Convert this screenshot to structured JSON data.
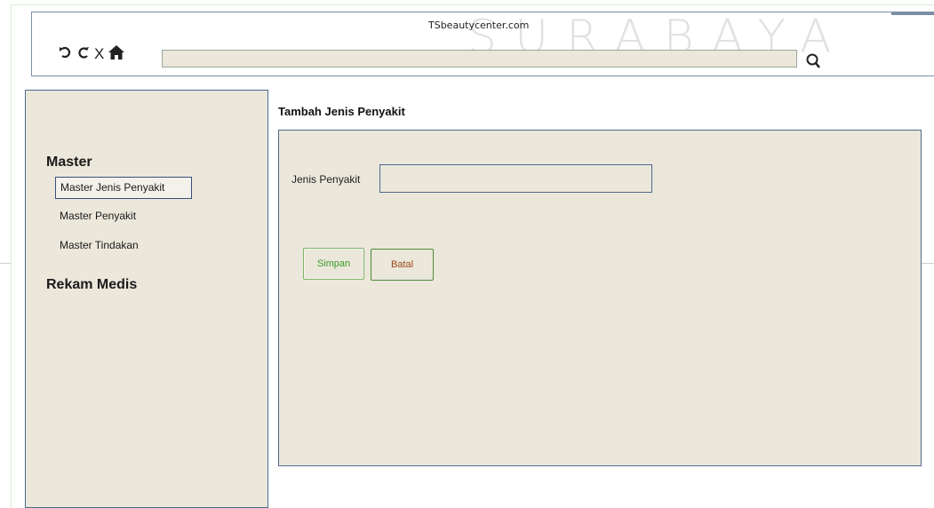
{
  "browser": {
    "site_title": "TSbeautycenter.com",
    "watermark": "SURABAYA",
    "url_value": "",
    "icons": [
      "back-icon",
      "reload-icon",
      "close-icon",
      "home-icon",
      "search-icon"
    ]
  },
  "sidebar": {
    "sections": [
      {
        "heading": "Master",
        "items": [
          {
            "label": "Master Jenis Penyakit",
            "active": true
          },
          {
            "label": "Master Penyakit",
            "active": false
          },
          {
            "label": "Master Tindakan",
            "active": false
          }
        ]
      },
      {
        "heading": "Rekam Medis",
        "items": []
      }
    ]
  },
  "main": {
    "title": "Tambah Jenis Penyakit",
    "form": {
      "field_label": "Jenis Penyakit",
      "field_value": "",
      "save_label": "Simpan",
      "cancel_label": "Batal"
    }
  },
  "colors": {
    "panel_bg": "#ebe7da",
    "panel_border": "#4d6a8c",
    "save_text": "#3a9a2a",
    "cancel_text": "#9a4a1a"
  }
}
